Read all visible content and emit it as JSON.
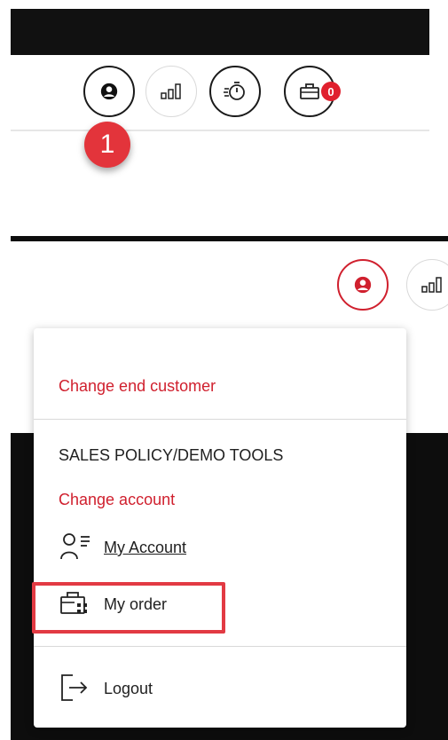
{
  "step_marker": "1",
  "cart_count": "0",
  "icons": {
    "user": "user-icon",
    "compare": "bar-chart-icon",
    "quick_order": "stopwatch-icon",
    "cart": "basket-icon",
    "account": "person-list-icon",
    "order": "order-icon",
    "logout": "logout-icon"
  },
  "menu": {
    "change_end_customer": "Change end customer",
    "section_heading": "SALES POLICY/DEMO TOOLS",
    "change_account": "Change account",
    "my_account": "My Account",
    "my_order": "My order",
    "logout": "Logout"
  },
  "colors": {
    "accent_red": "#d0202e",
    "header_black": "#111111",
    "highlight_red": "#e23a43"
  }
}
